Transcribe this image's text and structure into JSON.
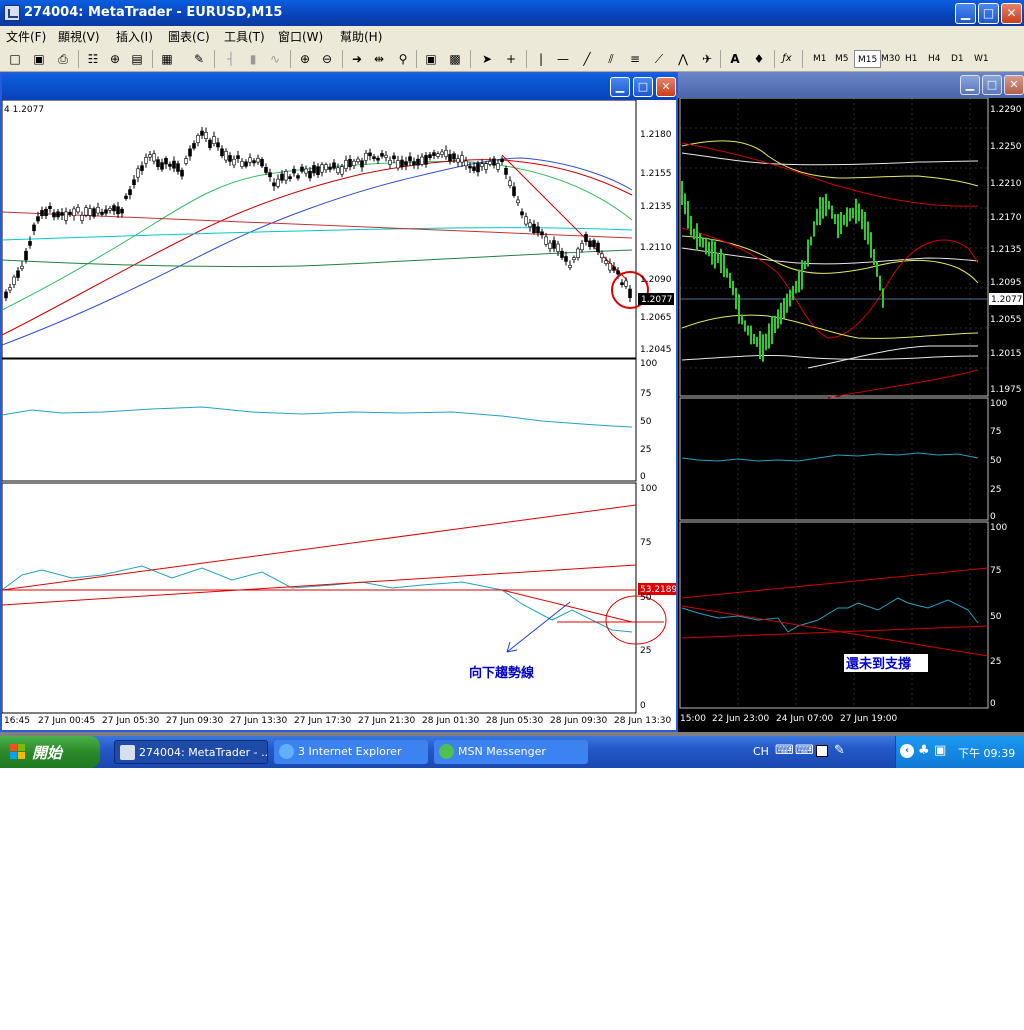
{
  "window": {
    "title": "274004: MetaTrader - EURUSD,M15",
    "controls": {
      "minimize": "▁",
      "maximize": "□",
      "close": "✕"
    }
  },
  "menu": [
    "文件(F)",
    "顯視(V)",
    "插入(I)",
    "圖表(C)",
    "工具(T)",
    "窗口(W)",
    "幫助(H)"
  ],
  "toolbar": {
    "timeframes": [
      "M1",
      "M5",
      "M15",
      "M30",
      "H1",
      "H4",
      "D1",
      "W1"
    ],
    "active_timeframe": "M15",
    "icons": [
      "new-chart-icon",
      "open-icon",
      "save-icon",
      "print-icon",
      "market-watch-icon",
      "navigator-icon",
      "data-window-icon",
      "terminal-icon",
      "expert-icon",
      "bar-chart-icon",
      "candle-chart-icon",
      "line-chart-icon",
      "zoom-in-icon",
      "zoom-out-icon",
      "autoscroll-icon",
      "chart-shift-icon",
      "periods-icon",
      "templates-icon",
      "tile-icon",
      "cursor-icon",
      "crosshair-icon",
      "vertical-line-icon",
      "horizontal-line-icon",
      "trendline-icon",
      "channel-icon",
      "fibonacci-icon",
      "gann-icon",
      "text-icon",
      "arrow-label-icon",
      "fractals-icon"
    ]
  },
  "chart1": {
    "header_price": "4 1.2077",
    "current_price": "1.2077",
    "price_ticks": [
      "1.2180",
      "1.2155",
      "1.2135",
      "1.2110",
      "1.2090",
      "1.2065",
      "1.2045"
    ],
    "ind1_ticks": [
      "100",
      "75",
      "50",
      "25",
      "0"
    ],
    "ind2_ticks": [
      "100",
      "75",
      "50",
      "25",
      "0"
    ],
    "ind2_value": "53.2189",
    "time_labels": [
      "16:45",
      "27 Jun 00:45",
      "27 Jun 05:30",
      "27 Jun 09:30",
      "27 Jun 13:30",
      "27 Jun 17:30",
      "27 Jun 21:30",
      "28 Jun 01:30",
      "28 Jun 05:30",
      "28 Jun 09:30",
      "28 Jun 13:30"
    ],
    "annotation": "向下趨勢線"
  },
  "chart2": {
    "current_price": "1.2077",
    "price_ticks": [
      "1.2290",
      "1.2250",
      "1.2210",
      "1.2170",
      "1.2135",
      "1.2095",
      "1.2055",
      "1.2015",
      "1.1975"
    ],
    "ind1_ticks": [
      "100",
      "75",
      "50",
      "25",
      "0"
    ],
    "ind2_ticks": [
      "100",
      "75",
      "50",
      "25",
      "0"
    ],
    "time_labels": [
      "15:00",
      "22 Jun 23:00",
      "24 Jun 07:00",
      "27 Jun 19:00"
    ],
    "annotation": "還未到支撐"
  },
  "taskbar": {
    "start_label": "開始",
    "tasks": [
      "274004: MetaTrader - ...",
      "3 Internet Explorer",
      "MSN Messenger"
    ],
    "lang": "CH",
    "clock": "下午 09:39"
  },
  "colors": {
    "title_blue": "#0842b8",
    "chart2_bg": "#000000",
    "candle_green": "#32c832",
    "ma_red": "#d00000",
    "ma_blue": "#3050d0",
    "ma_teal": "#00c8c8",
    "annotation_blue": "#0000cc"
  }
}
